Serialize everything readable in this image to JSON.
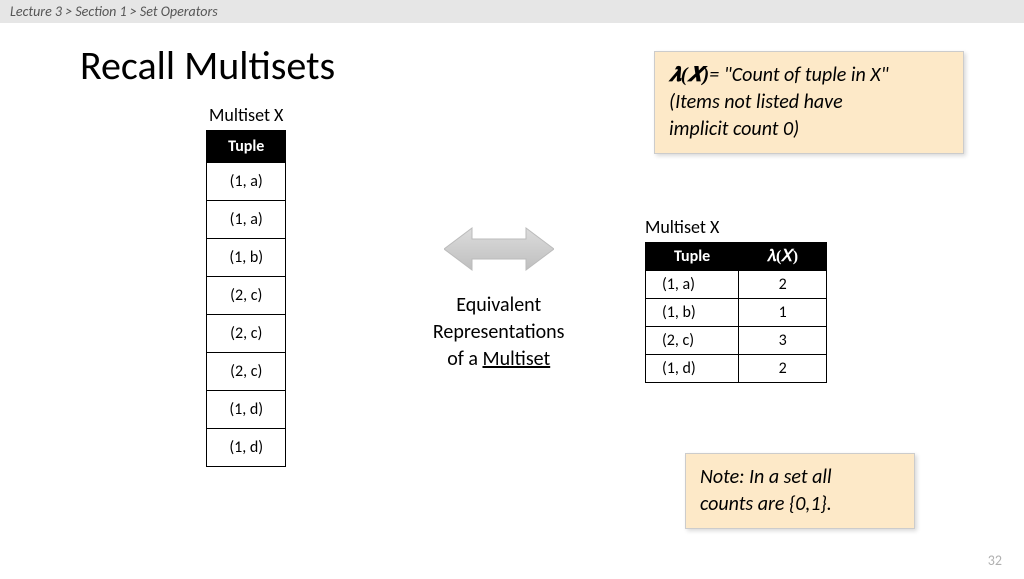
{
  "breadcrumb": "Lecture 3  >  Section 1  >  Set Operators",
  "title": "Recall Multisets",
  "left": {
    "label": "Multiset X",
    "header": "Tuple",
    "rows": [
      "(1, a)",
      "(1, a)",
      "(1, b)",
      "(2, c)",
      "(2, c)",
      "(2, c)",
      "(1, d)",
      "(1, d)"
    ]
  },
  "arrow": {
    "line1": "Equivalent",
    "line2": "Representations",
    "line3_prefix": "of a ",
    "line3_underlined": "Multiset"
  },
  "callout_top": {
    "lambda": "𝝀(𝑿)",
    "rest1": "= \"Count of tuple in X\"",
    "rest2": "(Items not listed have",
    "rest3": "implicit count 0)"
  },
  "right": {
    "label": "Multiset X",
    "h1": "Tuple",
    "h2": "𝜆(𝑋)",
    "rows": [
      {
        "t": "(1, a)",
        "c": "2"
      },
      {
        "t": "(1, b)",
        "c": "1"
      },
      {
        "t": "(2, c)",
        "c": "3"
      },
      {
        "t": "(1, d)",
        "c": "2"
      }
    ]
  },
  "callout_bot": {
    "l1": "Note: In a set all",
    "l2": "counts are {0,1}."
  },
  "page": "32"
}
